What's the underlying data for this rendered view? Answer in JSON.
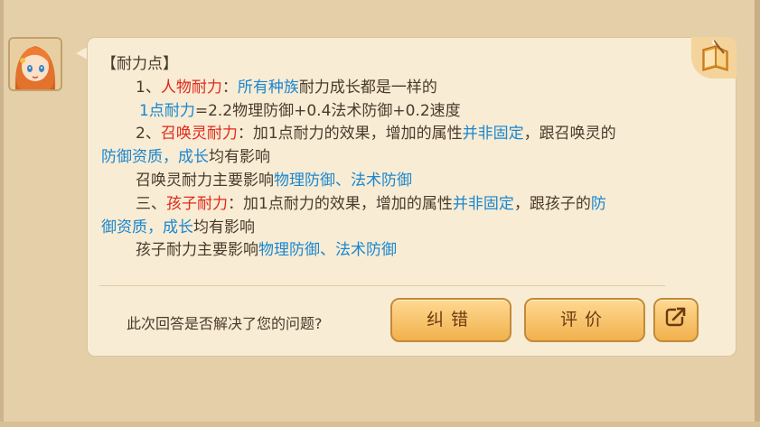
{
  "answer": {
    "heading": "【耐力点】",
    "l1": {
      "n": "1、",
      "t1": "人物耐力",
      "t2": "：",
      "t3": "所有种族",
      "t4": "耐力成长都是一样的"
    },
    "l2": {
      "t1": "1点耐力",
      "t2": "=2.2物理防御+0.4法术防御+0.2速度"
    },
    "l3": {
      "n": "2、",
      "t1": "召唤灵耐力",
      "t2": "：加1点耐力的效果，增加的属性",
      "t3": "并非固定",
      "t4": "，跟召唤灵的"
    },
    "l4": {
      "t1": "防御资质",
      "t2": "，",
      "t3": "成长",
      "t4": "均有影响"
    },
    "l5": {
      "t1": "召唤灵耐力主要影响",
      "t2": "物理防御、法术防御"
    },
    "l6": {
      "n": "三、",
      "t1": "孩子耐力",
      "t2": "：加1点耐力的效果，增加的属性",
      "t3": "并非固定",
      "t4": "，跟孩子的",
      "t5": "防"
    },
    "l7": {
      "t1": "御资质",
      "t2": "，",
      "t3": "成长",
      "t4": "均有影响"
    },
    "l8": {
      "t1": "孩子耐力主要影响",
      "t2": "物理防御、法术防御"
    }
  },
  "feedback": {
    "question": "此次回答是否解决了您的问题?",
    "correct_label": "纠错",
    "rate_label": "评价"
  },
  "icons": {
    "avatar": "girl-avatar",
    "book": "book-quill-icon",
    "share": "share-arrow-icon"
  },
  "colors": {
    "red_keyword": "#e0281c",
    "blue_keyword": "#1a86d0",
    "button_gold": "#f1b14d"
  }
}
